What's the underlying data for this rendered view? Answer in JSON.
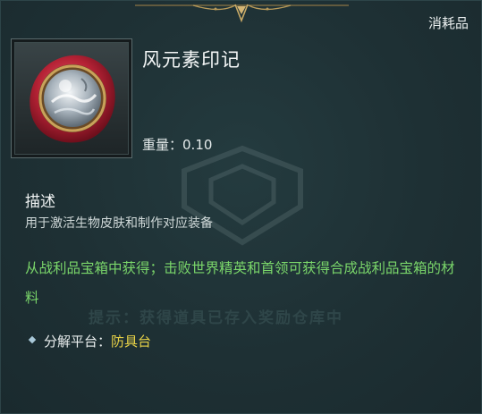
{
  "header": {
    "item_type": "消耗品"
  },
  "item": {
    "name": "风元素印记",
    "icon": "wind-element-seal-icon",
    "weight_label": "重量：",
    "weight_value": "0.10"
  },
  "description": {
    "title": "描述",
    "text": "用于激活生物皮肤和制作对应装备"
  },
  "source": {
    "text": "从战利品宝箱中获得；击败世界精英和首领可获得合成战利品宝箱的材料"
  },
  "hint": {
    "text": "提示：获得道具已存入奖励仓库中"
  },
  "disassembly": {
    "label": "分解平台：",
    "value": "防具台"
  },
  "colors": {
    "background": "#1f3236",
    "source_green": "#7ad66a",
    "platform_yellow": "#e8d247",
    "gold_ornament": "#b89a5a"
  }
}
